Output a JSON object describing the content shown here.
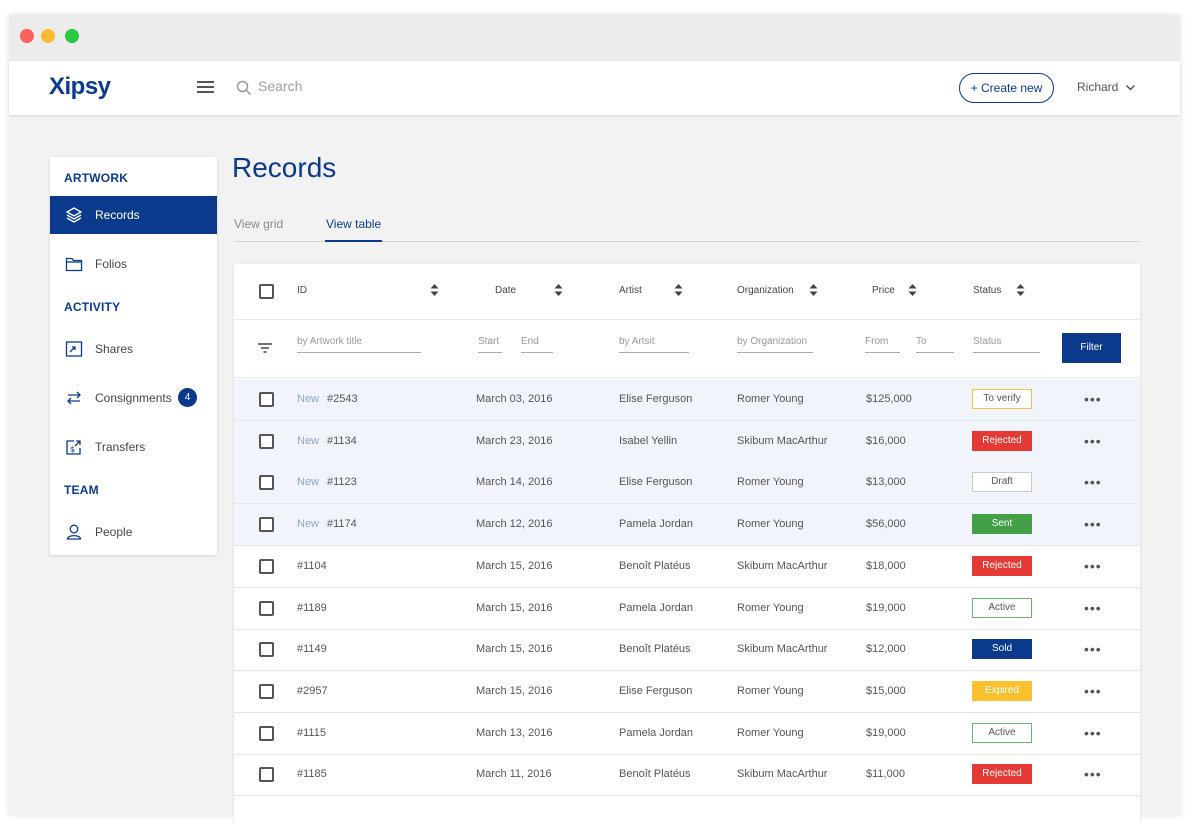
{
  "app": {
    "logo": "Xipsy"
  },
  "topbar": {
    "search_placeholder": "Search",
    "create_label": "+ Create new",
    "user_name": "Richard"
  },
  "sidebar": {
    "artwork_heading": "ARTWORK",
    "activity_heading": "ACTIVITY",
    "team_heading": "TEAM",
    "records": "Records",
    "folios": "Folios",
    "shares": "Shares",
    "consignments": "Consignments",
    "consignments_count": "4",
    "transfers": "Transfers",
    "people": "People"
  },
  "main": {
    "title": "Records",
    "tab_grid": "View grid",
    "tab_table": "View table"
  },
  "table": {
    "headers": {
      "id": "ID",
      "date": "Date",
      "artist": "Artist",
      "organization": "Organization",
      "price": "Price",
      "status": "Status"
    },
    "filters": {
      "artwork_title": "by Artwork title",
      "start": "Start",
      "end": "End",
      "artist": "by Artsit",
      "organization": "by Organization",
      "from": "From",
      "to": "To",
      "status": "Status",
      "button": "Filter"
    },
    "new_label": "New",
    "rows": [
      {
        "new": true,
        "id": "#2543",
        "date": "March 03, 2016",
        "artist": "Elise Ferguson",
        "org": "Romer Young",
        "price": "$125,000",
        "status": "To verify"
      },
      {
        "new": true,
        "id": "#1134",
        "date": "March 23, 2016",
        "artist": "Isabel Yellin",
        "org": "Skibum MacArthur",
        "price": "$16,000",
        "status": "Rejected"
      },
      {
        "new": true,
        "id": "#1123",
        "date": "March 14, 2016",
        "artist": "Elise Ferguson",
        "org": "Romer Young",
        "price": "$13,000",
        "status": "Draft"
      },
      {
        "new": true,
        "id": "#1174",
        "date": "March 12, 2016",
        "artist": "Pamela Jordan",
        "org": "Romer Young",
        "price": "$56,000",
        "status": "Sent"
      },
      {
        "new": false,
        "id": "#1104",
        "date": "March 15, 2016",
        "artist": "Benoît Platéus",
        "org": "Skibum MacArthur",
        "price": "$18,000",
        "status": "Rejected"
      },
      {
        "new": false,
        "id": "#1189",
        "date": "March 15, 2016",
        "artist": "Pamela Jordan",
        "org": "Romer Young",
        "price": "$19,000",
        "status": "Active"
      },
      {
        "new": false,
        "id": "#1149",
        "date": "March 15, 2016",
        "artist": "Benoît Platéus",
        "org": "Skibum MacArthur",
        "price": "$12,000",
        "status": "Sold"
      },
      {
        "new": false,
        "id": "#2957",
        "date": "March 15, 2016",
        "artist": "Elise Ferguson",
        "org": "Romer Young",
        "price": "$15,000",
        "status": "Expired"
      },
      {
        "new": false,
        "id": "#1115",
        "date": "March 13, 2016",
        "artist": "Pamela Jordan",
        "org": "Romer Young",
        "price": "$19,000",
        "status": "Active"
      },
      {
        "new": false,
        "id": "#1185",
        "date": "March 11, 2016",
        "artist": "Benoît Platéus",
        "org": "Skibum MacArthur",
        "price": "$11,000",
        "status": "Rejected"
      }
    ],
    "more_label": "•••"
  },
  "colors": {
    "brand": "#0b3a8c",
    "to_verify_border": "#f0c040",
    "rejected": "#e53935",
    "draft_border": "#cccccc",
    "sent": "#43a047",
    "active_border": "#66bb6a",
    "sold": "#0b3a8c",
    "expired": "#fbc02d"
  }
}
